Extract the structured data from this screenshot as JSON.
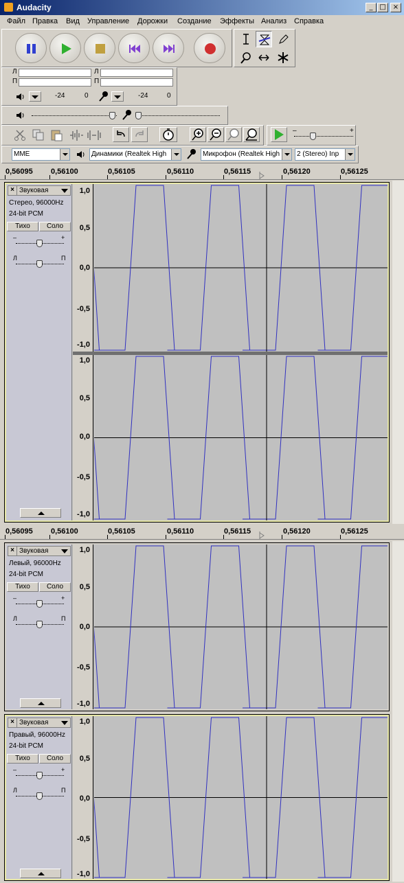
{
  "window": {
    "title": "Audacity",
    "min": "_",
    "max": "□",
    "close": "×"
  },
  "menu": [
    "Файл",
    "Правка",
    "Вид",
    "Управление",
    "Дорожки",
    "Создание",
    "Эффекты",
    "Анализ",
    "Справка"
  ],
  "meters": {
    "left_ch": "Л",
    "right_ch": "П",
    "play_db": "-24",
    "play_zero": "0",
    "rec_db": "-24",
    "rec_zero": "0"
  },
  "device": {
    "host": "MME",
    "output": "Динамики (Realtek High",
    "input": "Микрофон (Realtek High",
    "channels": "2 (Stereo) Inp"
  },
  "ruler_labels": [
    "0,56095",
    "0,56100",
    "0,56105",
    "0,56110",
    "0,56115",
    "0,56120",
    "0,56125"
  ],
  "track_buttons": {
    "mute": "Тихо",
    "solo": "Соло"
  },
  "pan": {
    "minus": "–",
    "plus": "+",
    "left": "Л",
    "right": "П"
  },
  "tracks": [
    {
      "name": "Звуковая",
      "info1": "Стерео, 96000Hz",
      "info2": "24-bit PCM",
      "scale": [
        "1,0",
        "0,5",
        "0,0",
        "-0,5",
        "-1,0"
      ]
    },
    {
      "name": "Звуковая",
      "info1": "Левый, 96000Hz",
      "info2": "24-bit PCM",
      "scale": [
        "1,0",
        "0,5",
        "0,0",
        "-0,5",
        "-1,0"
      ]
    },
    {
      "name": "Звуковая",
      "info1": "Правый, 96000Hz",
      "info2": "24-bit PCM",
      "scale": [
        "1,0",
        "0,5",
        "0,0",
        "-0,5",
        "-1,0"
      ]
    }
  ],
  "colors": {
    "waveform": "#3030c0",
    "track_bg": "#c0c0c0",
    "selected_border": "#e8e8a8"
  }
}
